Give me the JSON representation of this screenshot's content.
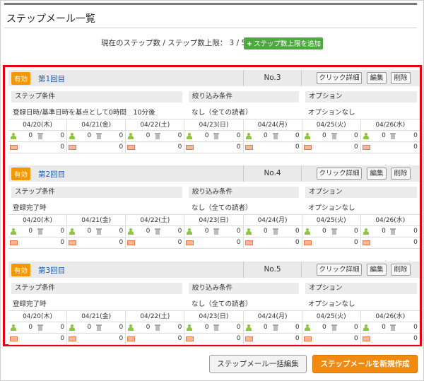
{
  "page": {
    "title": "ステップメール一覧"
  },
  "summary": {
    "count_text": "現在のステップ数 / ステップ数上限： 3 / 50",
    "add_limit_label": "ステップ数上限を追加"
  },
  "columns": {
    "condition": "ステップ条件",
    "filter": "絞り込み条件",
    "option": "オプション"
  },
  "buttons": {
    "detail": "クリック詳細",
    "edit": "編集",
    "delete": "削除"
  },
  "steps": [
    {
      "status": "有効",
      "name": "第1回目",
      "number": "No.3",
      "condition": "登録日時/基準日時を基点として0時間　10分後",
      "filter": "なし（全ての読者）",
      "option": "オプションなし"
    },
    {
      "status": "有効",
      "name": "第2回目",
      "number": "No.4",
      "condition": "登録完了時",
      "filter": "なし（全ての読者）",
      "option": "オプションなし"
    },
    {
      "status": "有効",
      "name": "第3回目",
      "number": "No.5",
      "condition": "登録完了時",
      "filter": "なし（全ての読者）",
      "option": "オプションなし"
    }
  ],
  "dates": [
    "04/20(木)",
    "04/21(金)",
    "04/22(土)",
    "04/23(日)",
    "04/24(月)",
    "04/25(火)",
    "04/26(水)"
  ],
  "stats": {
    "users": "0",
    "deleted": "0",
    "sent": "0"
  },
  "footer": {
    "bulk_edit_label": "ステップメール一括編集",
    "new_label": "ステップメールを新規作成"
  }
}
